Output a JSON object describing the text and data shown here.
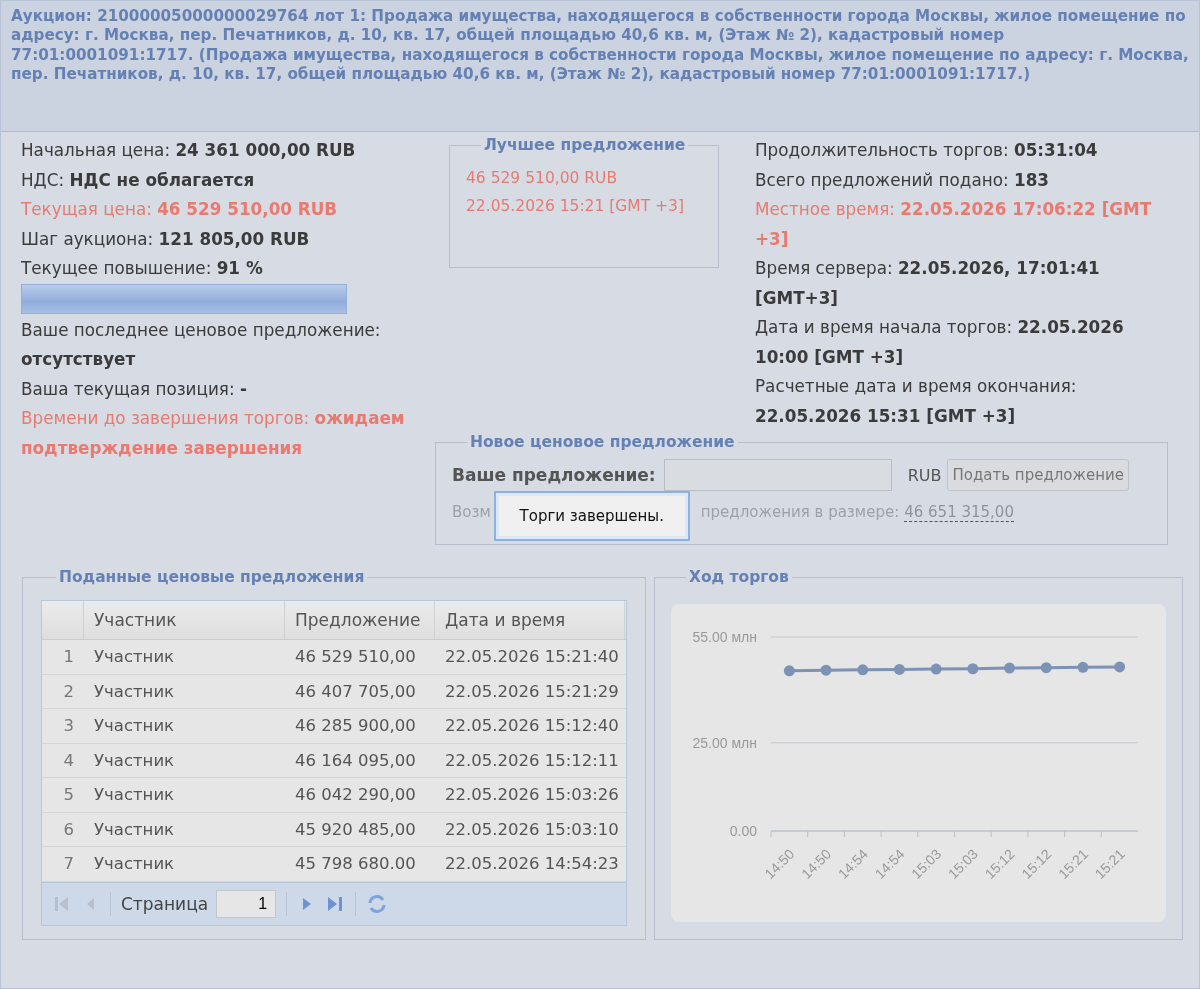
{
  "header": {
    "title": "Аукцион: 21000005000000029764 лот 1: Продажа имущества, находящегося в собственности города Москвы, жилое помещение по адресу: г. Москва, пер. Печатников, д. 10, кв. 17, общей площадью 40,6 кв. м, (Этаж № 2), кадастровый номер 77:01:0001091:1717. (Продажа имущества, находящегося в собственности города Москвы, жилое помещение по адресу: г. Москва, пер. Печатников, д. 10, кв. 17, общей площадью 40,6 кв. м, (Этаж № 2), кадастровый номер 77:01:0001091:1717.)"
  },
  "info_left": [
    {
      "kind": "normal",
      "text": "Начальная цена: **24 361 000,00 RUB**"
    },
    {
      "kind": "normal",
      "text": "НДС: **НДС не облагается**"
    },
    {
      "kind": "alert",
      "text": "Текущая цена: **46 529 510,00 RUB**"
    },
    {
      "kind": "normal",
      "text": "Шаг аукциона: **121 805,00 RUB**"
    },
    {
      "kind": "normal",
      "text": "Текущее повышение: **91 %**"
    },
    {
      "kind": "progress",
      "level": 1.0
    },
    {
      "kind": "normal",
      "text": "Ваше последнее ценовое предложение: **отсутствует**"
    },
    {
      "kind": "normal",
      "text": "Ваша текущая позиция: **-**"
    },
    {
      "kind": "alert",
      "text": "Времени до завершения торгов: **ожидаем подтверждение завершения**"
    }
  ],
  "best_offer": {
    "legend": "Лучшее предложение",
    "amount": "46 529 510,00 RUB",
    "time": "22.05.2026 15:21 [GMT +3]"
  },
  "info_right": [
    {
      "kind": "normal",
      "text": "Продолжительность торгов: **05:31:04**"
    },
    {
      "kind": "normal",
      "text": "Всего предложений подано: **183**"
    },
    {
      "kind": "alert",
      "text": "Местное время: **22.05.2026 17:06:22 [GMT +3]**"
    },
    {
      "kind": "normal",
      "text": "Время сервера: **22.05.2026, 17:01:41 [GMT+3]**"
    },
    {
      "kind": "normal",
      "text": "Дата и время начала торгов: **22.05.2026 10:00 [GMT +3]**"
    },
    {
      "kind": "normal",
      "text": "Расчетные дата и время окончания: **22.05.2026 15:31 [GMT +3]**"
    }
  ],
  "new_bid": {
    "legend": "Новое ценовое предложение",
    "label": "Ваше предложение:",
    "currency": "RUB",
    "button": "Подать предложение",
    "hint_start": "Возм",
    "hint_end": "предложения в размере:",
    "min_amount": "46 651 315,00",
    "disabled": true
  },
  "popup": {
    "message": "Торги завершены."
  },
  "bids": {
    "legend": "Поданные ценовые предложения",
    "columns": [
      "Участник",
      "Предложение",
      "Дата и время"
    ],
    "rows": [
      {
        "n": "1",
        "participant": "Участник",
        "amount": "46 529 510,00",
        "time": "22.05.2026 15:21:40"
      },
      {
        "n": "2",
        "participant": "Участник",
        "amount": "46 407 705,00",
        "time": "22.05.2026 15:21:29"
      },
      {
        "n": "3",
        "participant": "Участник",
        "amount": "46 285 900,00",
        "time": "22.05.2026 15:12:40"
      },
      {
        "n": "4",
        "participant": "Участник",
        "amount": "46 164 095,00",
        "time": "22.05.2026 15:12:11"
      },
      {
        "n": "5",
        "participant": "Участник",
        "amount": "46 042 290,00",
        "time": "22.05.2026 15:03:26"
      },
      {
        "n": "6",
        "participant": "Участник",
        "amount": "45 920 485,00",
        "time": "22.05.2026 15:03:10"
      },
      {
        "n": "7",
        "participant": "Участник",
        "amount": "45 798 680.00",
        "time": "22.05.2026 14:54:23"
      }
    ],
    "pager": {
      "label": "Страница",
      "page": "1"
    }
  },
  "progress": {
    "legend": "Ход торгов",
    "chart_data": {
      "type": "line",
      "categories": [
        "14:50",
        "14:50",
        "14:54",
        "14:54",
        "15:03",
        "15:03",
        "15:12",
        "15:12",
        "15:21",
        "15:21"
      ],
      "series": [
        {
          "color": "#7d93b5",
          "marker": "circle",
          "values": [
            45.4,
            45.6,
            45.7,
            45.8,
            45.9,
            46.0,
            46.2,
            46.3,
            46.4,
            46.5
          ]
        }
      ],
      "ylim": [
        0,
        55
      ],
      "yticks": [
        {
          "value": 0,
          "label": "0.00"
        },
        {
          "value": 25,
          "label": "25.00 млн"
        },
        {
          "value": 55,
          "label": "55.00 млн"
        }
      ]
    }
  }
}
